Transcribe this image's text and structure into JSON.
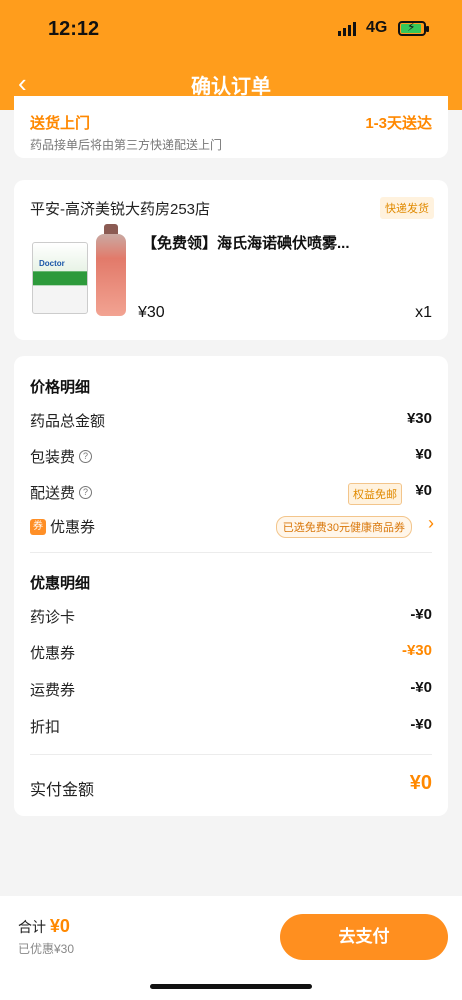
{
  "status_bar": {
    "time": "12:12",
    "network": "4G"
  },
  "nav": {
    "back_icon": "chevron-left-icon",
    "title": "确认订单"
  },
  "delivery": {
    "title": "送货上门",
    "time": "1-3天送达",
    "note": "药品接单后将由第三方快递配送上门"
  },
  "store": {
    "name": "平安-高济美锐大药房253店",
    "badge": "快递发货",
    "product": {
      "name": "【免费领】海氏海诺碘伏喷雾...",
      "tube_brand": "Doctor",
      "price": "¥30",
      "qty": "x1"
    }
  },
  "price_detail": {
    "title": "价格明细",
    "rows": [
      {
        "label": "药品总金额",
        "value": "¥30"
      },
      {
        "label": "包装费",
        "value": "¥0"
      },
      {
        "label": "配送费",
        "value": "¥0",
        "badge": "权益免邮"
      },
      {
        "label": "优惠券",
        "tag": "券",
        "chip": "已选免费30元健康商品券"
      }
    ]
  },
  "discount_detail": {
    "title": "优惠明细",
    "rows": [
      {
        "label": "药诊卡",
        "value": "-¥0"
      },
      {
        "label": "优惠券",
        "value": "-¥30"
      },
      {
        "label": "运费券",
        "value": "-¥0"
      },
      {
        "label": "折扣",
        "value": "-¥0"
      }
    ]
  },
  "actual": {
    "label": "实付金额",
    "value": "¥0"
  },
  "bottom": {
    "total_label": "合计",
    "total_value": "¥0",
    "saved": "已优惠¥30",
    "pay_label": "去支付"
  },
  "colors": {
    "brand": "#ff9d1c",
    "accent": "#ff8800"
  }
}
